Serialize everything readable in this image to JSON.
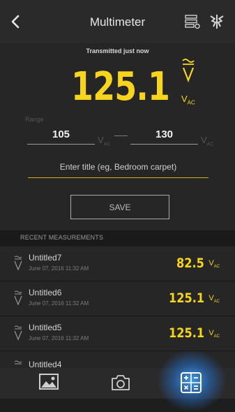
{
  "header": {
    "title": "Multimeter"
  },
  "reading": {
    "status": "Transmitted just now",
    "value": "125.1",
    "unit": "V",
    "unit_sub": "AC"
  },
  "range": {
    "label": "Range",
    "low": "105",
    "high": "130",
    "unit": "V",
    "unit_sub": "AC"
  },
  "form": {
    "title_placeholder": "Enter title (eg, Bedroom carpet)",
    "save_label": "SAVE"
  },
  "recent": {
    "header": "RECENT MEASUREMENTS",
    "items": [
      {
        "name": "Untitled7",
        "date": "June 07, 2016 11:32 AM",
        "value": "82.5",
        "unit": "V",
        "unit_sub": "AC"
      },
      {
        "name": "Untitled6",
        "date": "June 07, 2016 11:32 AM",
        "value": "125.1",
        "unit": "V",
        "unit_sub": "AC"
      },
      {
        "name": "Untitled5",
        "date": "June 07, 2016 11:32 AM",
        "value": "125.1",
        "unit": "V",
        "unit_sub": "AC"
      },
      {
        "name": "Untitled4"
      }
    ]
  },
  "colors": {
    "accent": "#f7d51d",
    "active_tab_glow": "#46aaff",
    "background": "#1e1e1e"
  },
  "icons": {
    "back": "chevron-left-icon",
    "list": "list-icon",
    "brand": "brand-logo-icon",
    "tabs": [
      "image-icon",
      "camera-icon",
      "calculator-icon"
    ]
  }
}
